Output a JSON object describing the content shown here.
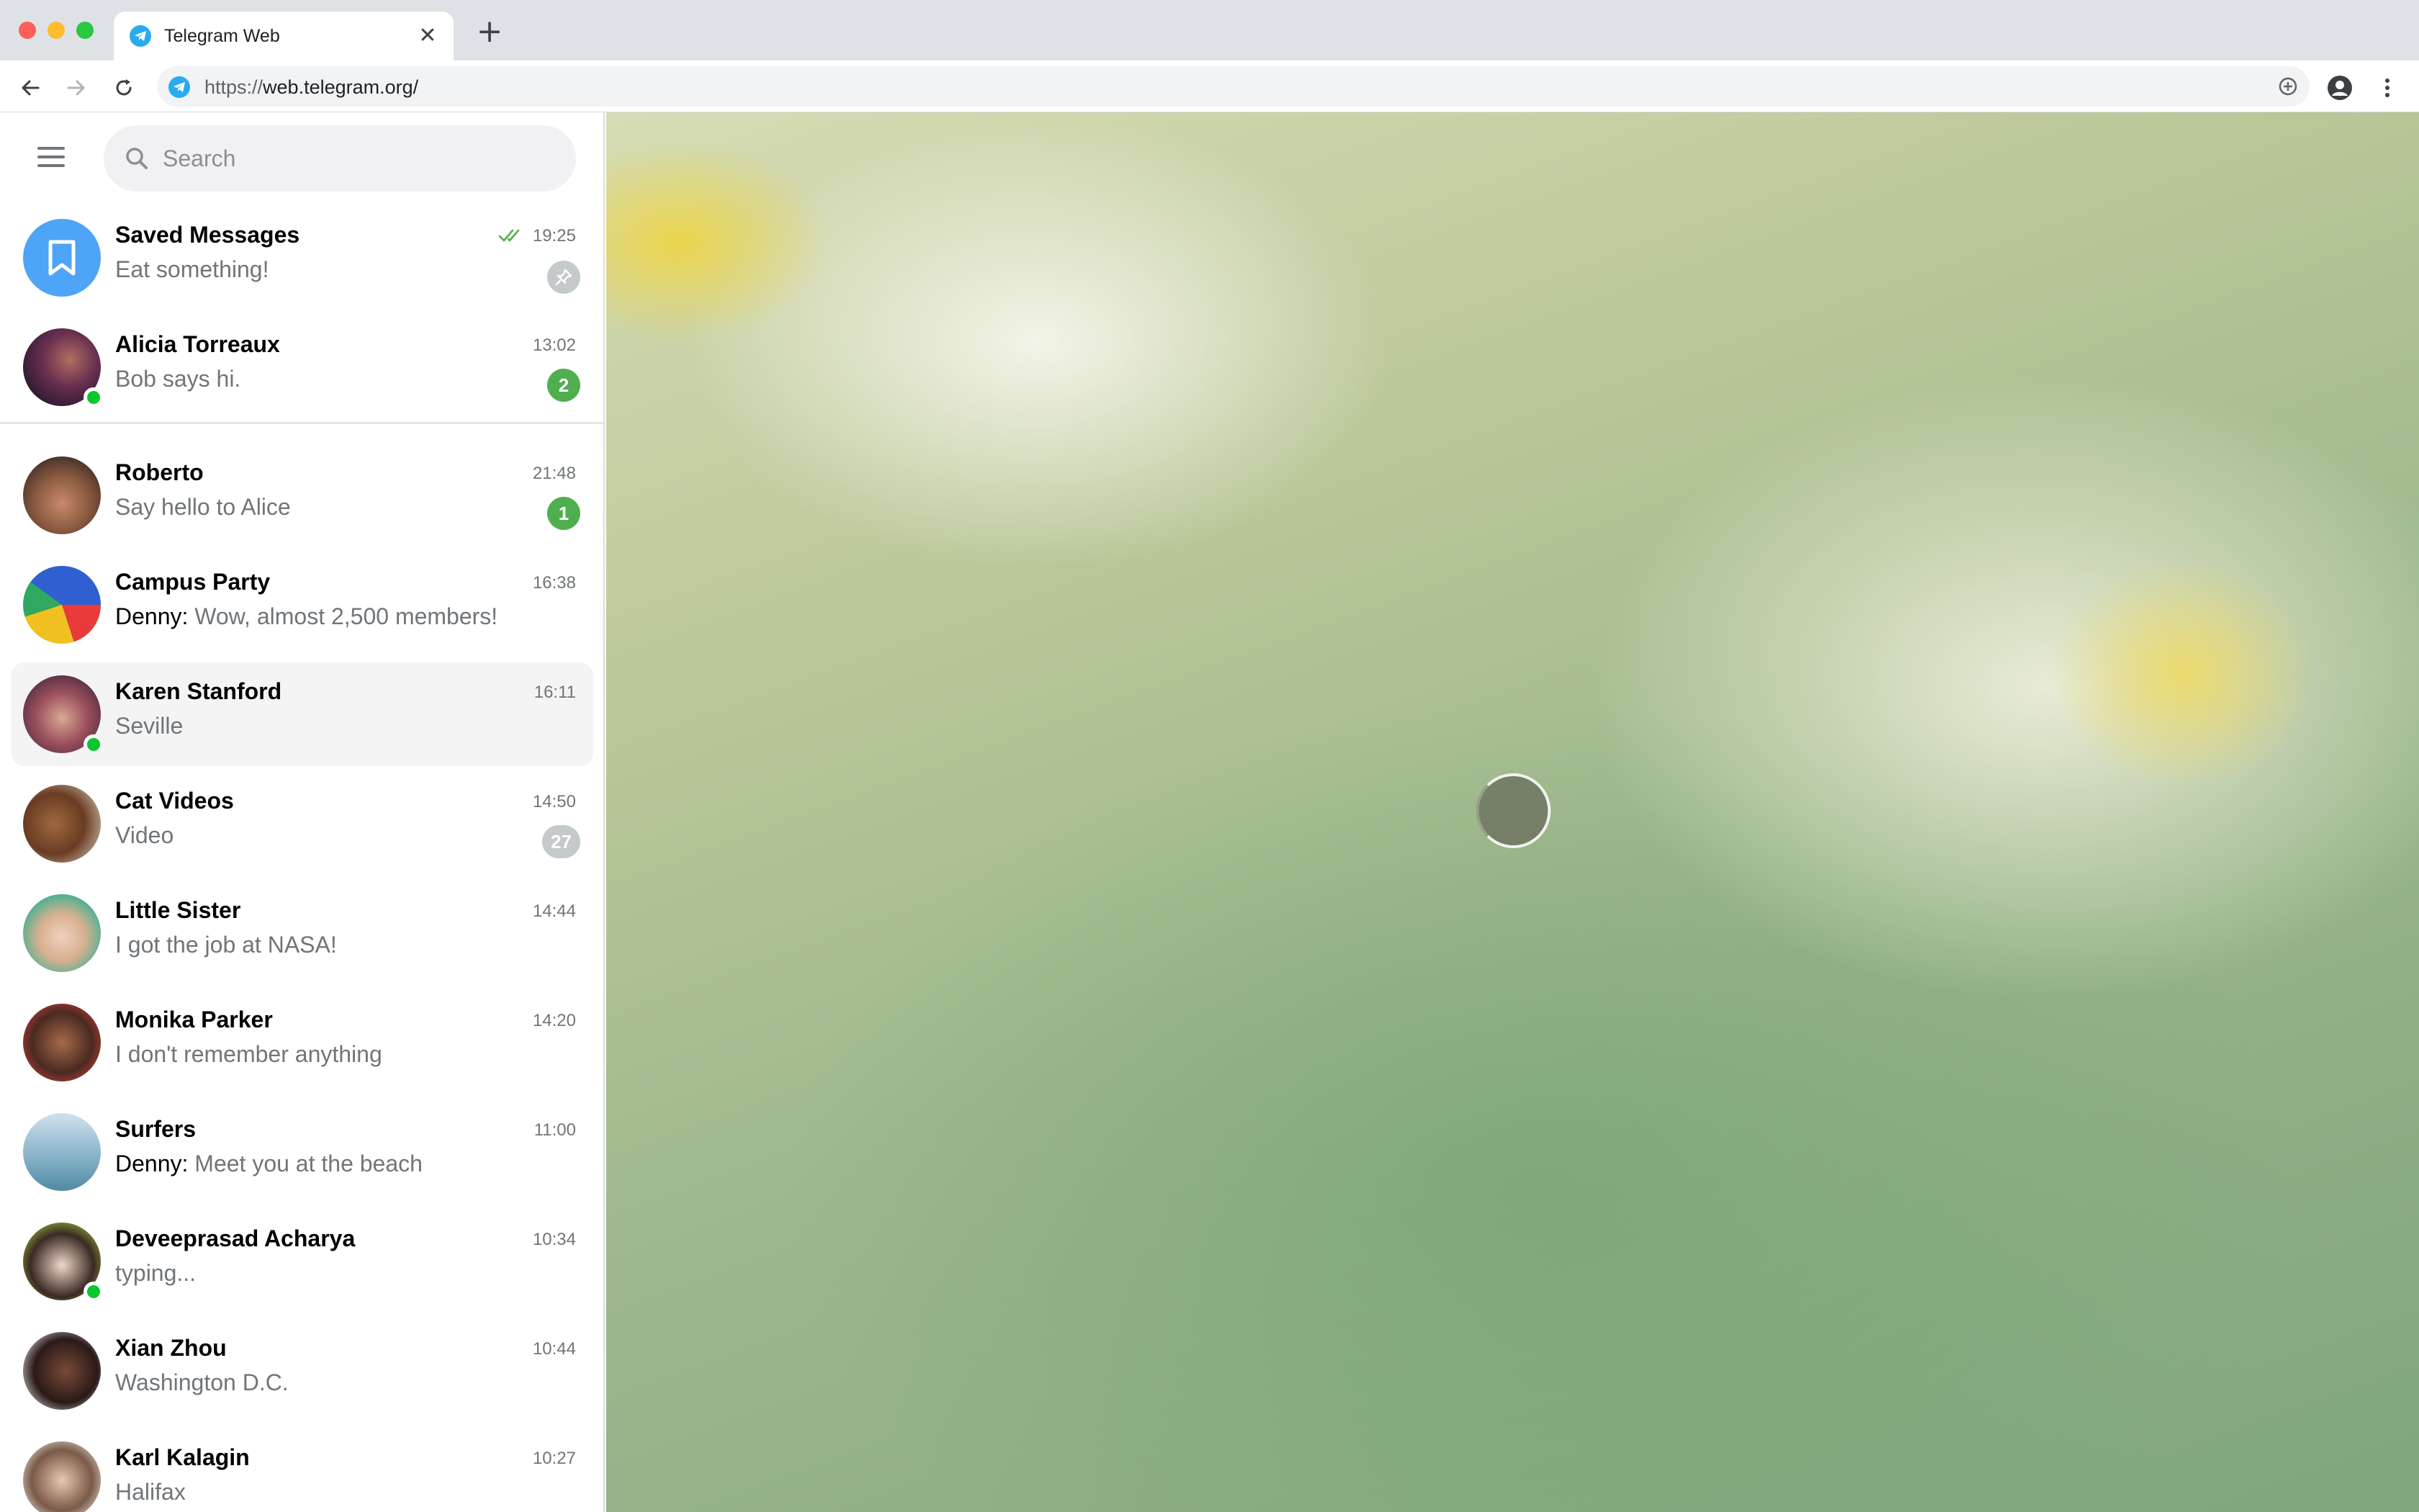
{
  "browser": {
    "tab_title": "Telegram Web",
    "tab_close": "✕",
    "new_tab": "+",
    "url_scheme": "https://",
    "url_host": "web.telegram.org/"
  },
  "search": {
    "placeholder": "Search"
  },
  "colors": {
    "accent": "#4ea4f6",
    "online": "#0ac630",
    "unread_badge": "#4fae4e",
    "muted_badge": "#c4c9cc"
  },
  "chats": [
    {
      "name": "Saved Messages",
      "time": "19:25",
      "message": "Eat something!",
      "avatar_icon": "bookmark-icon",
      "pinned": true,
      "read_receipt": "double-check-icon"
    },
    {
      "name": "Alicia Torreaux",
      "time": "13:02",
      "message": "Bob says hi.",
      "unread": "2",
      "online": true
    },
    {
      "name": "Roberto",
      "time": "21:48",
      "message": "Say hello to Alice",
      "unread": "1"
    },
    {
      "name": "Campus Party",
      "time": "16:38",
      "sender": "Denny:",
      "message": " Wow, almost 2,500 members!"
    },
    {
      "name": "Karen Stanford",
      "time": "16:11",
      "message": "Seville",
      "online": true,
      "active": true
    },
    {
      "name": "Cat Videos",
      "time": "14:50",
      "message": "Video",
      "unread": "27",
      "muted": true
    },
    {
      "name": "Little Sister",
      "time": "14:44",
      "message": "I got the job at NASA!"
    },
    {
      "name": "Monika Parker",
      "time": "14:20",
      "message": "I don't remember anything"
    },
    {
      "name": "Surfers",
      "time": "11:00",
      "sender": "Denny:",
      "message": " Meet you at the beach"
    },
    {
      "name": "Deveeprasad Acharya",
      "time": "10:34",
      "message": "typing...",
      "online": true
    },
    {
      "name": "Xian Zhou",
      "time": "10:44",
      "message": "Washington D.C."
    },
    {
      "name": "Karl Kalagin",
      "time": "10:27",
      "message": "Halifax"
    }
  ]
}
